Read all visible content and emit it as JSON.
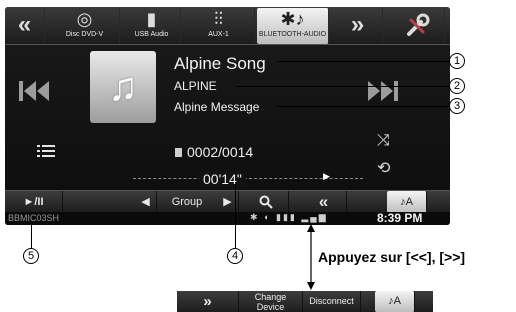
{
  "source_bar": {
    "back_arrow": "«",
    "sources": [
      {
        "label": "Disc DVD-V",
        "icon": "disc-icon"
      },
      {
        "label": "USB Audio",
        "icon": "usb-icon"
      },
      {
        "label": "AUX-1",
        "icon": "aux-mixer-icon"
      },
      {
        "label": "BLUETOOTH-AUDIO",
        "icon": "bluetooth-audio-icon"
      }
    ],
    "forward_arrow": "»",
    "setup_icon": "setup-tools-icon"
  },
  "now_playing": {
    "song_title": "Alpine Song",
    "artist": "ALPINE",
    "message": "Alpine Message",
    "track_counter": "0002/0014",
    "elapsed_time": "00'14\""
  },
  "control_bar": {
    "play_pause": "►/II",
    "group_label": "Group",
    "search_icon": "search-icon",
    "rewind": "«",
    "mode_glyph": "♪A"
  },
  "status_bar": {
    "tuner_text": "BBMIC03SH",
    "clock": "8:39 PM"
  },
  "callouts": {
    "c1": "1",
    "c2": "2",
    "c3": "3",
    "c4": "4",
    "c5": "5",
    "note": "Appuyez sur [<<], [>>]"
  },
  "alternate_bar": {
    "forward": "»",
    "change_device_line1": "Change",
    "change_device_line2": "Device",
    "disconnect": "Disconnect",
    "mode_glyph": "♪A"
  }
}
